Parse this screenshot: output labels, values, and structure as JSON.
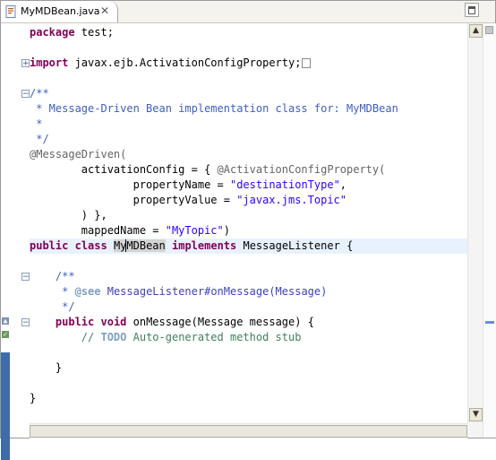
{
  "tab": {
    "label": "MyMDBean.java",
    "close_icon": "close-icon",
    "file_icon": "java-file-icon"
  },
  "editor": {
    "lines": [
      {
        "segments": [
          {
            "t": "package",
            "c": "kw"
          },
          {
            "t": " test;",
            "c": ""
          }
        ]
      },
      {
        "segments": []
      },
      {
        "segments": [
          {
            "t": "import",
            "c": "kw"
          },
          {
            "t": " javax.ejb.ActivationConfigProperty;",
            "c": ""
          }
        ],
        "fold": "+"
      },
      {
        "segments": []
      },
      {
        "segments": [
          {
            "t": "/**",
            "c": "cm"
          }
        ],
        "fold": "-"
      },
      {
        "segments": [
          {
            "t": " * Message-Driven Bean implementation class for: MyMDBean",
            "c": "cm"
          }
        ]
      },
      {
        "segments": [
          {
            "t": " *",
            "c": "cm"
          }
        ]
      },
      {
        "segments": [
          {
            "t": " */",
            "c": "cm"
          }
        ]
      },
      {
        "segments": [
          {
            "t": "@MessageDriven(",
            "c": "ann"
          }
        ]
      },
      {
        "segments": [
          {
            "t": "        activationConfig = { ",
            "c": ""
          },
          {
            "t": "@ActivationConfigProperty(",
            "c": "ann"
          }
        ]
      },
      {
        "segments": [
          {
            "t": "                propertyName = ",
            "c": ""
          },
          {
            "t": "\"destinationType\"",
            "c": "str"
          },
          {
            "t": ",",
            "c": ""
          }
        ]
      },
      {
        "segments": [
          {
            "t": "                propertyValue = ",
            "c": ""
          },
          {
            "t": "\"javax.jms.Topic\"",
            "c": "str"
          }
        ]
      },
      {
        "segments": [
          {
            "t": "        ) },",
            "c": ""
          }
        ]
      },
      {
        "segments": [
          {
            "t": "        mappedName = ",
            "c": ""
          },
          {
            "t": "\"MyTopic\"",
            "c": "str"
          },
          {
            "t": ")",
            "c": ""
          }
        ]
      },
      {
        "segments": [
          {
            "t": "public",
            "c": "kw"
          },
          {
            "t": " ",
            "c": ""
          },
          {
            "t": "class",
            "c": "kw"
          },
          {
            "t": " ",
            "c": ""
          },
          {
            "t": "My",
            "c": "occ"
          },
          {
            "t": "MDBean",
            "c": "occ caret"
          },
          {
            "t": " ",
            "c": ""
          },
          {
            "t": "implements",
            "c": "kw"
          },
          {
            "t": " MessageListener {",
            "c": ""
          }
        ],
        "current": true
      },
      {
        "segments": []
      },
      {
        "segments": [
          {
            "t": "    /**",
            "c": "cm"
          }
        ],
        "fold": "-"
      },
      {
        "segments": [
          {
            "t": "     * ",
            "c": "cm"
          },
          {
            "t": "@see",
            "c": "tag"
          },
          {
            "t": " ",
            "c": "cm"
          },
          {
            "t": "MessageListener#onMessage(Message)",
            "c": "link"
          }
        ]
      },
      {
        "segments": [
          {
            "t": "     */",
            "c": "cm"
          }
        ]
      },
      {
        "segments": [
          {
            "t": "    ",
            "c": ""
          },
          {
            "t": "public",
            "c": "kw"
          },
          {
            "t": " ",
            "c": ""
          },
          {
            "t": "void",
            "c": "kw"
          },
          {
            "t": " onMessage(Message message) {",
            "c": ""
          }
        ],
        "fold": "-"
      },
      {
        "segments": [
          {
            "t": "        // ",
            "c": "c2"
          },
          {
            "t": "TODO",
            "c": "todo"
          },
          {
            "t": " Auto-generated method stub",
            "c": "c2"
          }
        ]
      },
      {
        "segments": []
      },
      {
        "segments": [
          {
            "t": "    }",
            "c": ""
          }
        ]
      },
      {
        "segments": []
      },
      {
        "segments": [
          {
            "t": "}",
            "c": ""
          }
        ]
      }
    ]
  },
  "scrollbars": {
    "vertical_up_icon": "arrow-up-icon",
    "vertical_down_icon": "arrow-down-icon"
  }
}
